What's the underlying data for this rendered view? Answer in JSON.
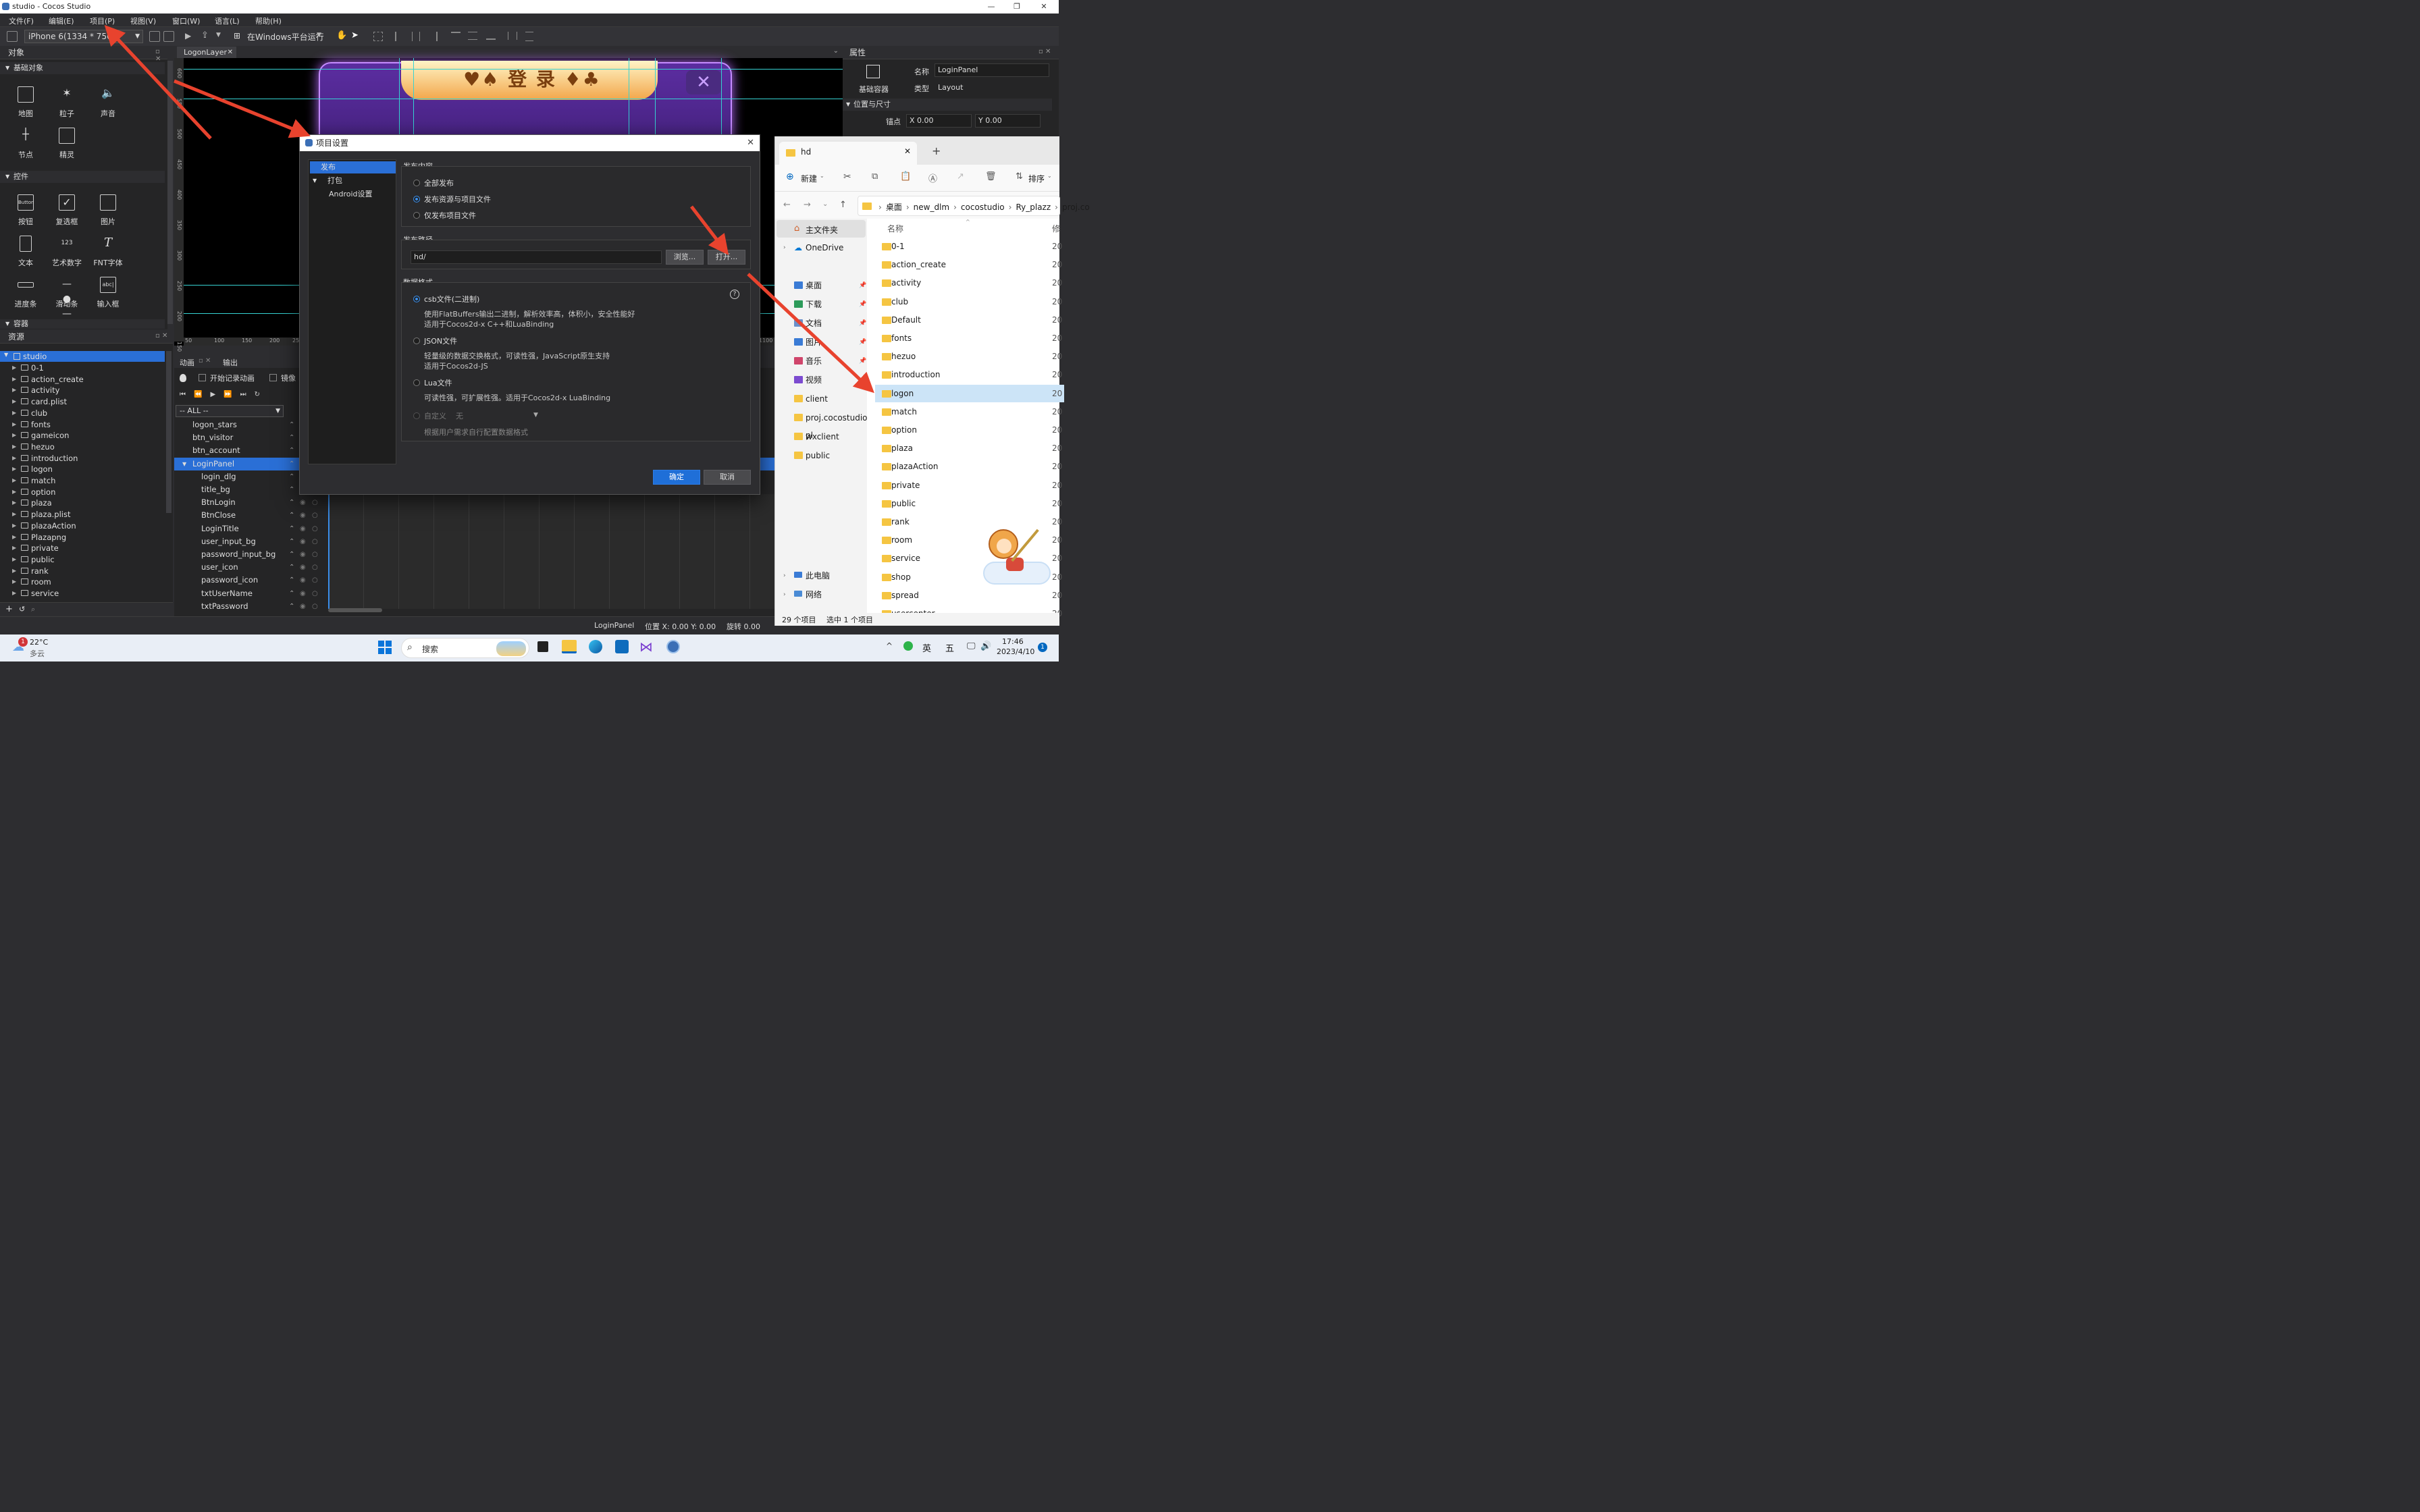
{
  "window": {
    "title": "studio - Cocos Studio"
  },
  "menu": [
    "文件(F)",
    "编辑(E)",
    "项目(P)",
    "视图(V)",
    "窗口(W)",
    "语言(L)",
    "帮助(H)"
  ],
  "toolbar": {
    "device": "iPhone 6(1334 * 750)",
    "run": "在Windows平台运行"
  },
  "objects_panel": {
    "title": "对象",
    "basic_section": "基础对象",
    "basic": [
      "地图",
      "粒子",
      "声音",
      "节点",
      "精灵"
    ],
    "controls_section": "控件",
    "controls": [
      "按钮",
      "复选框",
      "图片",
      "文本",
      "艺术数字",
      "FNT字体",
      "进度条",
      "滑动条",
      "输入框"
    ],
    "container_section": "容器",
    "icon_texts": {
      "button": "Button",
      "art": "123",
      "input": "abc|"
    }
  },
  "resources_panel": {
    "title": "资源",
    "root": "studio",
    "items": [
      "0-1",
      "action_create",
      "activity",
      "card.plist",
      "club",
      "fonts",
      "gameicon",
      "hezuo",
      "introduction",
      "logon",
      "match",
      "option",
      "plaza",
      "plaza.plist",
      "plazaAction",
      "Plazapng",
      "private",
      "public",
      "rank",
      "room",
      "service"
    ]
  },
  "canvas": {
    "tab": "LogonLayer",
    "game_title": "♥♠ 登 录 ♦♣",
    "ruler_left": [
      "600",
      "550",
      "500",
      "450",
      "400",
      "350",
      "300",
      "250",
      "200",
      "150"
    ],
    "ruler_bottom": [
      "50",
      "100",
      "150",
      "200",
      "25",
      "1100"
    ]
  },
  "animation_panel": {
    "tabs": [
      "动画",
      "输出"
    ],
    "record": "开始记录动画",
    "mirror": "镜像",
    "filter": "-- ALL --",
    "nodes": [
      "logon_stars",
      "btn_visitor",
      "btn_account",
      "LoginPanel",
      "login_dlg",
      "title_bg",
      "BtnLogin",
      "BtnClose",
      "LoginTitle",
      "user_input_bg",
      "password_input_bg",
      "user_icon",
      "password_icon",
      "txtUserName",
      "txtPassword"
    ],
    "selected": "LoginPanel"
  },
  "properties": {
    "title": "属性",
    "type_icon_label": "基础容器",
    "name_label": "名称",
    "name_value": "LoginPanel",
    "type_label": "类型",
    "type_value": "Layout",
    "section": "位置与尺寸",
    "anchor_label": "锚点",
    "anchor_x": "X  0.00",
    "anchor_y": "Y  0.00"
  },
  "dialog": {
    "title": "项目设置",
    "nav": [
      "发布",
      "打包",
      "Android设置"
    ],
    "content_label": "发布内容",
    "content_options": [
      "全部发布",
      "发布资源与项目文件",
      "仅发布项目文件"
    ],
    "path_label": "发布路径",
    "path_value": "hd/",
    "browse": "浏览...",
    "open": "打开...",
    "format_label": "数据格式",
    "formats": [
      {
        "name": "csb文件(二进制)",
        "desc1": "使用FlatBuffers输出二进制，解析效率高，体积小，安全性能好",
        "desc2": "适用于Cocos2d-x C++和LuaBinding"
      },
      {
        "name": "JSON文件",
        "desc1": "轻量级的数据交换格式，可读性强，JavaScript原生支持",
        "desc2": "适用于Cocos2d-JS"
      },
      {
        "name": "Lua文件",
        "desc1": "可读性强，可扩展性强。适用于Cocos2d-x LuaBinding",
        "desc2": ""
      }
    ],
    "custom_label": "自定义",
    "custom_value": "无",
    "custom_desc": "根据用户需求自行配置数据格式",
    "help": "?",
    "ok": "确定",
    "cancel": "取消"
  },
  "explorer": {
    "tab": "hd",
    "new_btn": "新建",
    "sort_btn": "排序",
    "breadcrumb": [
      "桌面",
      "new_dlm",
      "cocostudio",
      "Ry_plazz",
      "proj.co"
    ],
    "nav_top": [
      "主文件夹",
      "OneDrive"
    ],
    "nav_quick": [
      "桌面",
      "下载",
      "文档",
      "图片",
      "音乐",
      "视频",
      "client",
      "proj.cocostudio-pl",
      "wxclient",
      "public"
    ],
    "nav_bottom": [
      "此电脑",
      "网络"
    ],
    "column_name": "名称",
    "column_mod": "修",
    "folders": [
      "0-1",
      "action_create",
      "activity",
      "club",
      "Default",
      "fonts",
      "hezuo",
      "introduction",
      "logon",
      "match",
      "option",
      "plaza",
      "plazaAction",
      "private",
      "public",
      "rank",
      "room",
      "service",
      "shop",
      "spread",
      "usercenter"
    ],
    "selected": "logon",
    "date_col": "20",
    "status_count": "29 个项目",
    "status_sel": "选中 1 个项目"
  },
  "statusbar": {
    "name": "LoginPanel",
    "pos": "位置 X: 0.00   Y: 0.00",
    "rot": "旋转 0.00"
  },
  "taskbar": {
    "weather_temp": "22°C",
    "weather_desc": "多云",
    "badge": "1",
    "search": "搜索",
    "ime1": "英",
    "ime2": "五",
    "time": "17:46",
    "date": "2023/4/10",
    "notify": "1"
  },
  "colors": {
    "accent": "#3b8eea",
    "arrow": "#e8432e",
    "selection": "#2a6fd6"
  }
}
